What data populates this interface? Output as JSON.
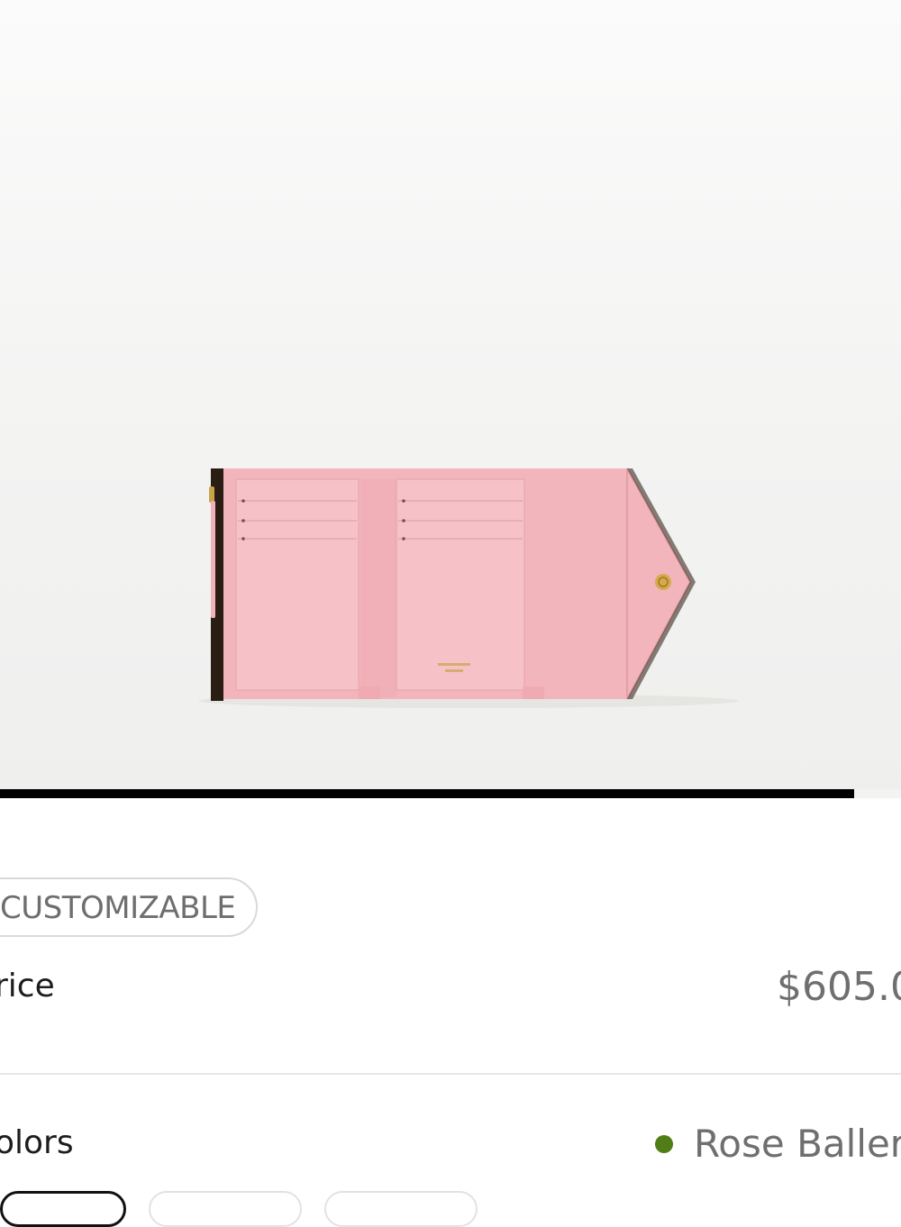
{
  "product": {
    "image_alt": "Rose Ballerine wallet, open view",
    "badge": "CUSTOMIZABLE",
    "price_label": "rice",
    "price": "$605.0",
    "colors_label": "olors",
    "selected_color": "Rose Ballerir",
    "selected_color_dot": "#4f7d16"
  },
  "gallery": {
    "progress_fraction": 0.948
  },
  "colors": {
    "wallet_pink": "#f3b6bd",
    "wallet_pink_light": "#f5c1c6",
    "text_gray": "#6f6f6f"
  }
}
